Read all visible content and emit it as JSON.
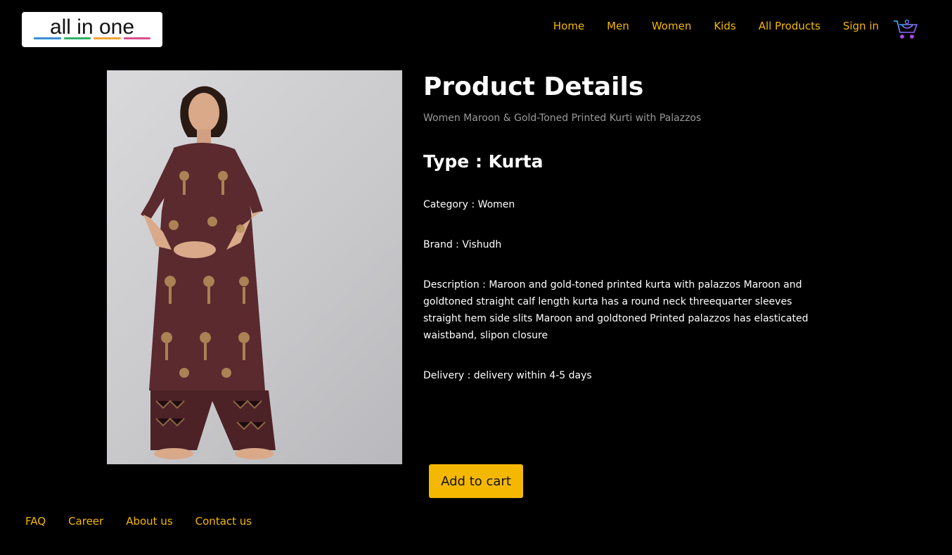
{
  "header": {
    "logo_text": "all in one",
    "logo_bar_colors": [
      "#3a8fd9",
      "#2fb36b",
      "#f2a33a",
      "#d84f8f"
    ],
    "nav": [
      {
        "label": "Home"
      },
      {
        "label": "Men"
      },
      {
        "label": "Women"
      },
      {
        "label": "Kids"
      },
      {
        "label": "All Products"
      },
      {
        "label": "Sign in"
      }
    ],
    "cart_icon": "shopping-cart-icon"
  },
  "product": {
    "heading": "Product Details",
    "name": "Women Maroon & Gold-Toned Printed Kurti with Palazzos",
    "type_label": "Type : ",
    "type_value": "Kurta",
    "category": "Category : Women",
    "brand": "Brand : Vishudh",
    "description": "Description : Maroon and gold-toned printed kurta with palazzos Maroon and goldtoned straight calf length kurta has a round neck threequarter sleeves straight hem side slits Maroon and goldtoned Printed palazzos has elasticated waistband, slipon closure",
    "delivery": "Delivery : delivery within 4-5 days",
    "add_to_cart_label": "Add to cart"
  },
  "footer": {
    "links": [
      {
        "label": "FAQ"
      },
      {
        "label": "Career"
      },
      {
        "label": "About us"
      },
      {
        "label": "Contact us"
      }
    ]
  },
  "colors": {
    "accent": "#f5b800",
    "background": "#000000",
    "kurta": "#5a2a2e",
    "gold_print": "#b8925a"
  }
}
